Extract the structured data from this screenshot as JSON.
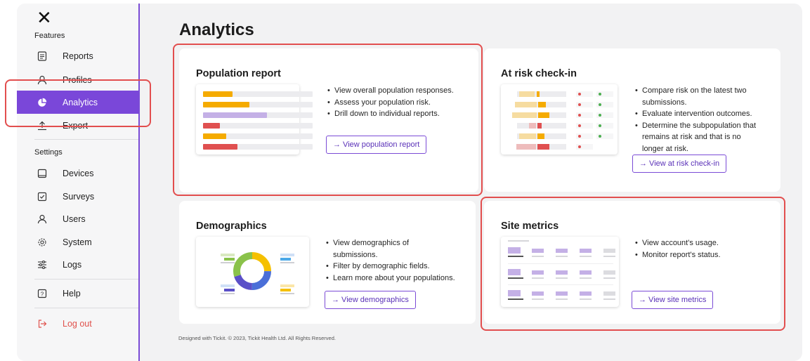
{
  "sidebar": {
    "features_label": "Features",
    "settings_label": "Settings",
    "items": [
      {
        "label": "Reports",
        "icon": "reports-icon"
      },
      {
        "label": "Profiles",
        "icon": "profile-icon"
      },
      {
        "label": "Analytics",
        "icon": "pie-chart-icon"
      },
      {
        "label": "Export",
        "icon": "export-icon"
      },
      {
        "label": "Devices",
        "icon": "tablet-icon"
      },
      {
        "label": "Surveys",
        "icon": "checkbox-icon"
      },
      {
        "label": "Users",
        "icon": "user-icon"
      },
      {
        "label": "System",
        "icon": "gear-icon"
      },
      {
        "label": "Logs",
        "icon": "sliders-icon"
      },
      {
        "label": "Help",
        "icon": "help-icon"
      },
      {
        "label": "Log out",
        "icon": "logout-icon"
      }
    ],
    "active_color": "#7a47d9"
  },
  "main": {
    "title": "Analytics",
    "cards": {
      "population": {
        "title": "Population report",
        "bullets": [
          "View overall population responses.",
          "Assess your population risk.",
          "Drill down to individual reports."
        ],
        "cta": "→ View population report"
      },
      "at_risk": {
        "title": "At risk check-in",
        "bullets": [
          "Compare risk on the latest two",
          "submissions.",
          "Evaluate intervention outcomes.",
          "Determine the subpopulation that",
          "remains at risk and that is no",
          "longer at risk."
        ],
        "cta": "→ View at risk check-in"
      },
      "demographics": {
        "title": "Demographics",
        "bullets": [
          "View demographics of",
          "submissions.",
          "Filter by demographic fields.",
          "Learn more about your populations."
        ],
        "cta": "→ View demographics"
      },
      "site_metrics": {
        "title": "Site metrics",
        "bullets": [
          "View account's usage.",
          "Monitor report's status."
        ],
        "cta": "→ View site metrics"
      }
    },
    "footer": "Designed with Tickit. © 2023, Tickit Health Ltd. All Rights Reserved."
  },
  "colors": {
    "accent": "#7a47d9",
    "highlight": "#e24e4e",
    "orange": "#f5ab00",
    "lavender": "#c4b0e6",
    "red": "#e05050"
  }
}
